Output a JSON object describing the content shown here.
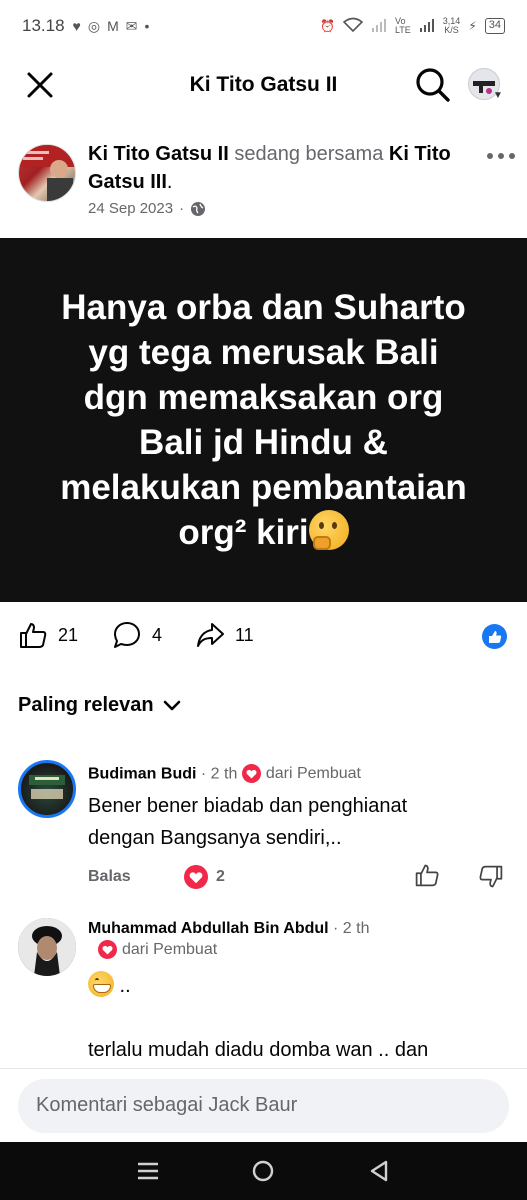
{
  "status_bar": {
    "time": "13.18",
    "net_speed": "3,14",
    "net_unit": "K/S",
    "battery": "34",
    "dot": "•"
  },
  "header": {
    "title": "Ki Tito Gatsu II"
  },
  "post": {
    "author": "Ki Tito Gatsu II",
    "with_text": "sedang bersama",
    "tagged": "Ki Tito Gatsu III",
    "period": ".",
    "date": "24 Sep 2023",
    "separator": "·",
    "image_text_lines": [
      "Hanya orba dan Suharto",
      "yg tega merusak Bali",
      "dgn memaksakan org",
      "Bali jd Hindu &",
      "melakukan pembantaian",
      "org² kiri"
    ],
    "likes": "21",
    "comments": "4",
    "shares": "11"
  },
  "comments_section": {
    "sort_label": "Paling relevan",
    "comments": [
      {
        "name": "Budiman Budi",
        "time": "· 2 th",
        "badge": "dari Pembuat",
        "text_lines": [
          "Bener bener biadab dan penghianat",
          "dengan Bangsanya sendiri,.."
        ],
        "reply_label": "Balas",
        "reactions": "2"
      },
      {
        "name": "Muhammad Abdullah Bin Abdul",
        "time": "· 2 th",
        "badge": "dari Pembuat",
        "text_line1_suffix": " ..",
        "text_line2": "terlalu mudah diadu domba wan .. dan"
      }
    ]
  },
  "composer": {
    "placeholder": "Komentari sebagai Jack Baur"
  },
  "colors": {
    "accent": "#1877f2",
    "heart": "#f02849",
    "muted": "#65676b",
    "image_bg": "#111111"
  }
}
